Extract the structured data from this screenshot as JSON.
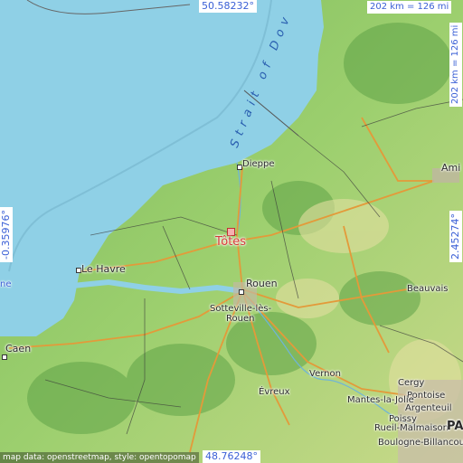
{
  "place": {
    "name": "Tôtes"
  },
  "coords": {
    "top": "50.58232°",
    "bottom": "48.76248°",
    "left": "-0.35976°",
    "right": "2.45274°"
  },
  "scale": {
    "horizontal": "202 km = 126 mi",
    "vertical": "202 km = 126 mi"
  },
  "sea": {
    "label": "Strait of Dov"
  },
  "towns": {
    "dieppe": "Dieppe",
    "lehavre": "Le Havre",
    "rouen": "Rouen",
    "sotteville": "Sotteville-lès-",
    "sotteville2": "Rouen",
    "caen": "Caen",
    "beauvais": "Beauvais",
    "vernon": "Vernon",
    "evreux": "Évreux",
    "cergy": "Cergy",
    "pontoise": "Pontoise",
    "mantes": "Mantes-la-Jolie",
    "argenteuil": "Argenteuil",
    "poissy": "Poissy",
    "rueil": "Rueil-Malmaison",
    "boulogne": "Boulogne-Billancourt",
    "amiens": "Ami",
    "paris": "PA",
    "edge_left": "ne"
  },
  "attribution": "map data: openstreetmap, style: opentopomap",
  "colors": {
    "sea": "#8fd0e6",
    "land": "#8cc66a",
    "highlight": "#d43a3a",
    "coord_text": "#3a5fd6"
  }
}
